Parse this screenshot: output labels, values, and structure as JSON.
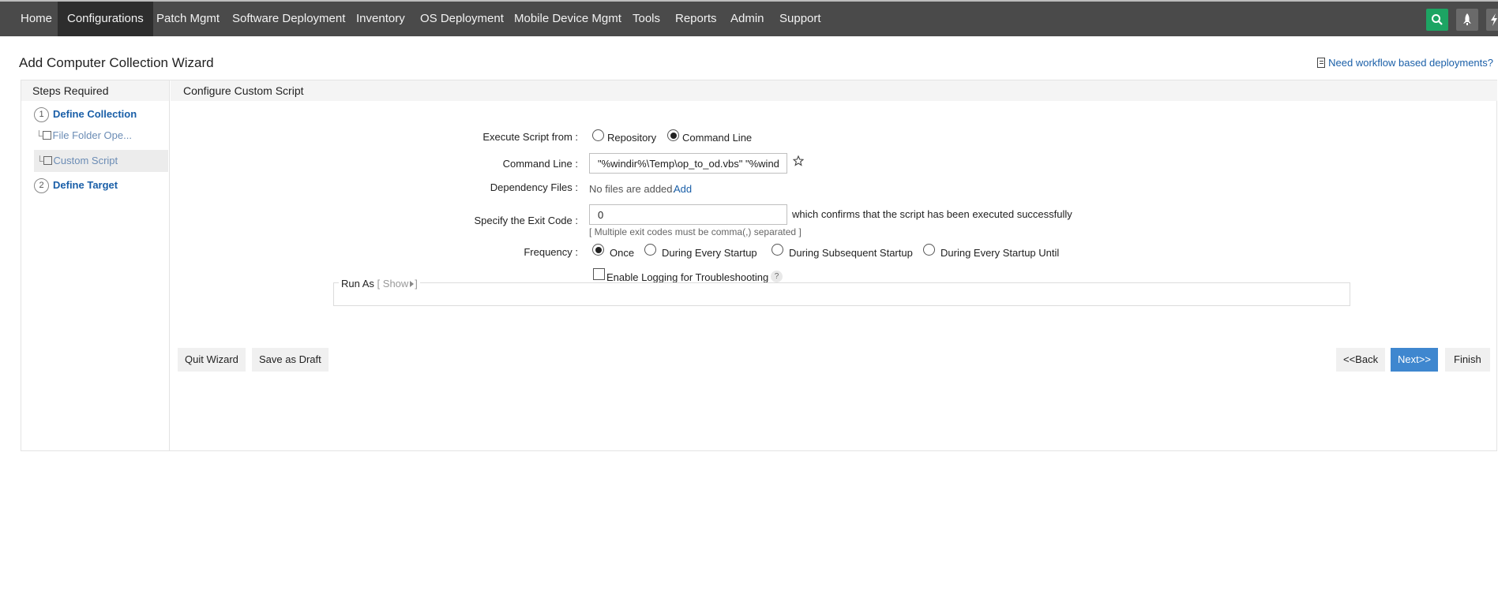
{
  "nav": {
    "items": [
      "Home",
      "Configurations",
      "Patch Mgmt",
      "Software Deployment",
      "Inventory",
      "OS Deployment",
      "Mobile Device Mgmt",
      "Tools",
      "Reports",
      "Admin",
      "Support"
    ],
    "active": "Configurations",
    "icons": [
      "search-icon",
      "rocket-icon",
      "bolt-icon"
    ]
  },
  "page": {
    "title": "Add Computer Collection Wizard",
    "workflow_link": "Need workflow based deployments?"
  },
  "steps": {
    "header": "Steps Required",
    "step1": {
      "num": "1",
      "label": "Define Collection"
    },
    "sub1": "File Folder Ope...",
    "sub2": "Custom Script",
    "step2": {
      "num": "2",
      "label": "Define Target"
    }
  },
  "main": {
    "header": "Configure Custom Script",
    "execute_from": {
      "label": "Execute Script from :",
      "options": [
        "Repository",
        "Command Line"
      ],
      "selected": "Command Line"
    },
    "command_line": {
      "label": "Command Line :",
      "value": "\"%windir%\\Temp\\op_to_od.vbs\" \"%windi"
    },
    "dependency": {
      "label": "Dependency Files :",
      "text": "No files are added.",
      "add": "Add"
    },
    "exit_code": {
      "label": "Specify the Exit Code :",
      "value": "0",
      "suffix": "which confirms that the script has been executed successfully",
      "hint": "[ Multiple exit codes must be comma(,) separated ]"
    },
    "frequency": {
      "label": "Frequency :",
      "options": [
        "Once",
        "During Every Startup",
        "During Subsequent Startup",
        "During Every Startup Until"
      ],
      "selected": "Once"
    },
    "logging": {
      "label": "Enable Logging for Troubleshooting",
      "checked": false,
      "help": "?"
    },
    "run_as": {
      "label": "Run As",
      "show_open": "[ Show",
      "show_close": "]"
    }
  },
  "buttons": {
    "quit": "Quit Wizard",
    "save_draft": "Save as Draft",
    "back": "<<Back",
    "next": "Next>>",
    "finish": "Finish"
  },
  "colors": {
    "nav_bg": "#4a4a4a",
    "nav_active": "#2d2d2d",
    "search_accent": "#1da463",
    "link": "#1a5fa8",
    "primary_button": "#3f87cf"
  }
}
